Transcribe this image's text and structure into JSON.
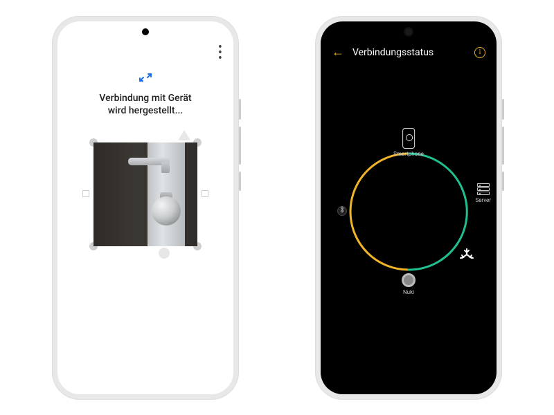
{
  "left": {
    "menu_aria": "Weitere Optionen",
    "title_line1": "Verbindung mit Gerät",
    "title_line2": "wird hergestellt...",
    "image_alt": "Türschloss mit Griff und Drehknauf"
  },
  "right": {
    "back_aria": "Zurück",
    "title": "Verbindungsstatus",
    "info_aria": "Info",
    "nodes": {
      "smartphone": "Smartphone",
      "server": "Server",
      "matter": "",
      "nuki": "Nuki",
      "bluetooth": ""
    },
    "colors": {
      "accent": "#f0b429",
      "ok": "#1fbf8f"
    }
  }
}
